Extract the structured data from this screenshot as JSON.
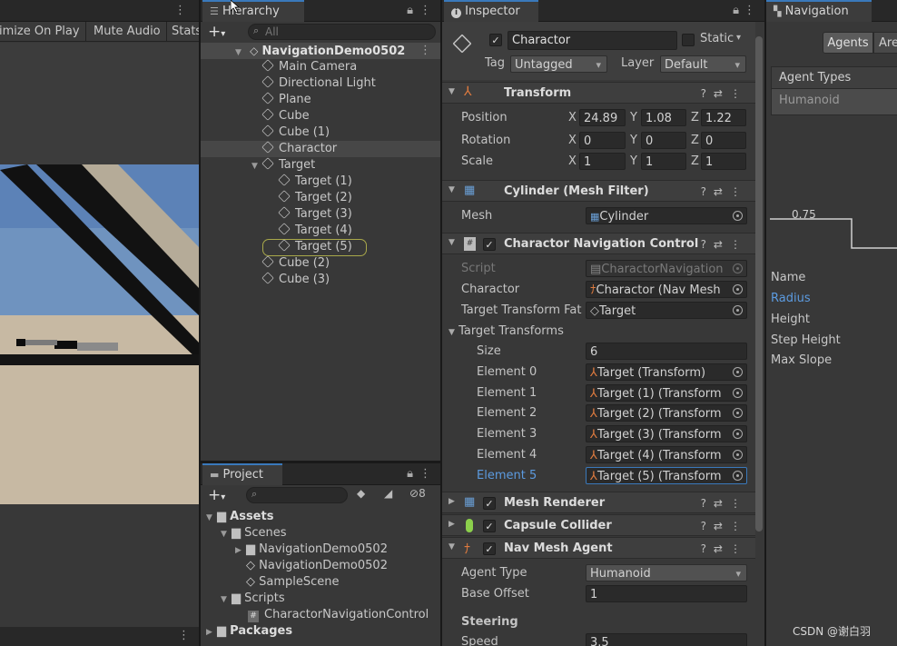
{
  "game_view": {
    "toolbar": {
      "maximize_label": "imize On Play",
      "mute_label": "Mute Audio",
      "stats_label": "Stats"
    }
  },
  "hierarchy": {
    "tab_label": "Hierarchy",
    "search_placeholder": "All",
    "scene_name": "NavigationDemo0502",
    "items": [
      {
        "label": "Main Camera"
      },
      {
        "label": "Directional Light"
      },
      {
        "label": "Plane"
      },
      {
        "label": "Cube"
      },
      {
        "label": "Cube (1)"
      },
      {
        "label": "Charactor"
      },
      {
        "label": "Target"
      },
      {
        "label": "Target (1)"
      },
      {
        "label": "Target (2)"
      },
      {
        "label": "Target (3)"
      },
      {
        "label": "Target (4)"
      },
      {
        "label": "Target (5)"
      },
      {
        "label": "Cube (2)"
      },
      {
        "label": "Cube (3)"
      }
    ]
  },
  "project": {
    "tab_label": "Project",
    "hidden_count": "8",
    "items": [
      {
        "label": "Assets"
      },
      {
        "label": "Scenes"
      },
      {
        "label": "NavigationDemo0502"
      },
      {
        "label": "NavigationDemo0502"
      },
      {
        "label": "SampleScene"
      },
      {
        "label": "Scripts"
      },
      {
        "label": "CharactorNavigationControl"
      },
      {
        "label": "Packages"
      }
    ]
  },
  "inspector": {
    "tab_label": "Inspector",
    "object_name": "Charactor",
    "static_label": "Static",
    "tag_label": "Tag",
    "tag_value": "Untagged",
    "layer_label": "Layer",
    "layer_value": "Default",
    "transform": {
      "title": "Transform",
      "position_label": "Position",
      "rotation_label": "Rotation",
      "scale_label": "Scale",
      "x": "X",
      "y": "Y",
      "z": "Z",
      "position": [
        "24.89",
        "1.08",
        "1.22"
      ],
      "rotation": [
        "0",
        "0",
        "0"
      ],
      "scale": [
        "1",
        "1",
        "1"
      ]
    },
    "mesh_filter": {
      "title": "Cylinder (Mesh Filter)",
      "mesh_label": "Mesh",
      "mesh_value": "Cylinder"
    },
    "nav_control": {
      "title": "Charactor Navigation Control",
      "script_label": "Script",
      "script_value": "CharactorNavigation",
      "charactor_label": "Charactor",
      "charactor_value": "Charactor (Nav Mesh",
      "target_label": "Target Transform Fat",
      "target_value": "Target",
      "transforms_label": "Target Transforms",
      "size_label": "Size",
      "size_value": "6",
      "elements": [
        {
          "label": "Element 0",
          "value": "Target (Transform)"
        },
        {
          "label": "Element 1",
          "value": "Target (1) (Transform"
        },
        {
          "label": "Element 2",
          "value": "Target (2) (Transform"
        },
        {
          "label": "Element 3",
          "value": "Target (3) (Transform"
        },
        {
          "label": "Element 4",
          "value": "Target (4) (Transform"
        },
        {
          "label": "Element 5",
          "value": "Target (5) (Transform"
        }
      ]
    },
    "mesh_renderer": {
      "title": "Mesh Renderer"
    },
    "capsule_collider": {
      "title": "Capsule Collider"
    },
    "nav_mesh_agent": {
      "title": "Nav Mesh Agent",
      "agent_type_label": "Agent Type",
      "agent_type_value": "Humanoid",
      "base_offset_label": "Base Offset",
      "base_offset_value": "1",
      "steering_label": "Steering",
      "speed_label": "Speed",
      "speed_value": "3.5"
    }
  },
  "navigation": {
    "tab_label": "Navigation",
    "agents_tab": "Agents",
    "areas_tab": "Are",
    "agent_types_label": "Agent Types",
    "humanoid_label": "Humanoid",
    "radius_value": "0.75",
    "props": [
      "Name",
      "Radius",
      "Height",
      "Step Height",
      "Max Slope"
    ]
  },
  "watermark": "CSDN @谢白羽",
  "colors": {
    "accent": "#3a79bb",
    "link": "#5c9be0",
    "highlight_ring": "#a9a84a"
  }
}
